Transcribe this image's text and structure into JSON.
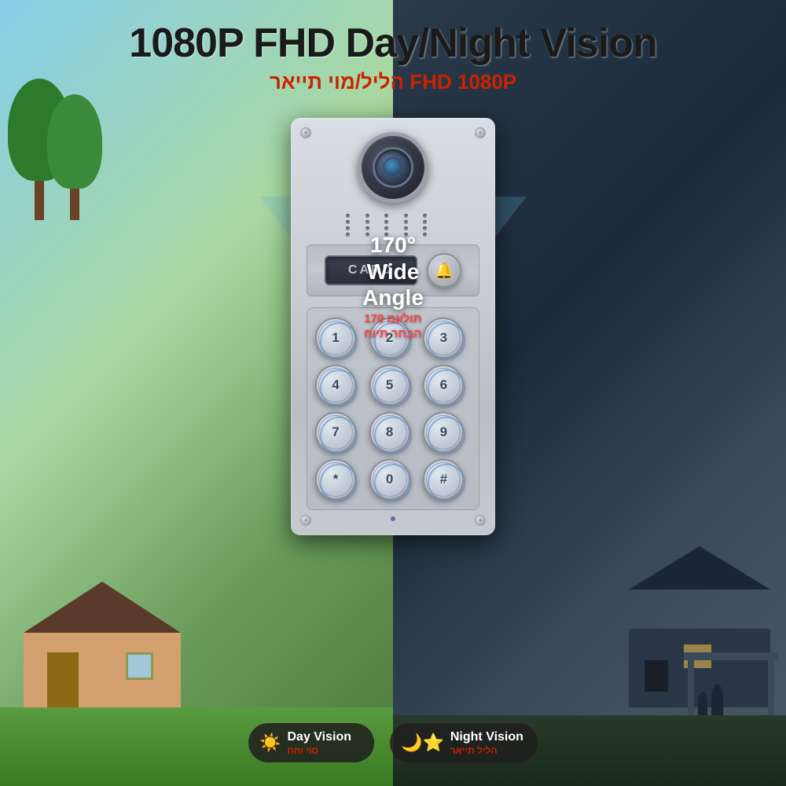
{
  "header": {
    "title_en": "1080P FHD Day/Night Vision",
    "title_he": "הליל/מוי תייאר FHD 1080P"
  },
  "angle": {
    "label_en_1": "170°",
    "label_en_2": "Wide Angle",
    "label_he_1": "תולעמ 170",
    "label_he_2": "הבחר תיוח"
  },
  "card_slot": {
    "label": "CARD"
  },
  "keypad": {
    "keys": [
      "1",
      "2",
      "3",
      "4",
      "5",
      "6",
      "7",
      "8",
      "9",
      "*",
      "0",
      "#"
    ]
  },
  "badges": [
    {
      "icon": "☀",
      "label_en": "Day Vision",
      "label_he": "סוי וחח"
    },
    {
      "icon": "☽★",
      "label_en": "Night Vision",
      "label_he": "הליל תייאר"
    }
  ]
}
